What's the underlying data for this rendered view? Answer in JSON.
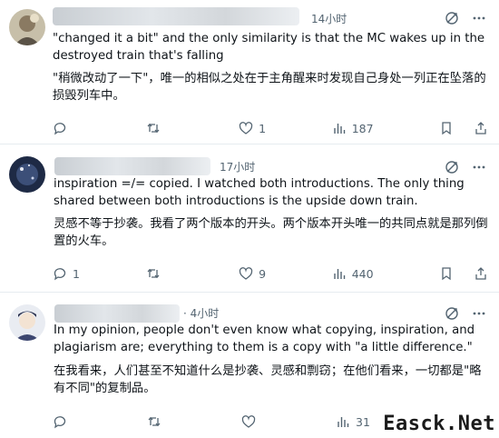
{
  "posts": [
    {
      "time": "14小时",
      "text_en": "\"changed it a bit\" and the only similarity is that the MC wakes up in the destroyed train that's falling",
      "text_zh": "\"稍微改动了一下\"，唯一的相似之处在于主角醒来时发现自己身处一列正在坠落的损毁列车中。",
      "reply_count": "",
      "retweet_count": "",
      "like_count": "1",
      "view_count": "187"
    },
    {
      "time": "17小时",
      "text_en": "inspiration =/= copied. I watched both introductions. The only thing shared between both introductions is the upside down train.",
      "text_zh": "灵感不等于抄袭。我看了两个版本的开头。两个版本开头唯一的共同点就是那列倒置的火车。",
      "reply_count": "1",
      "retweet_count": "",
      "like_count": "9",
      "view_count": "440"
    },
    {
      "time": "· 4小时",
      "text_en": "In my opinion, people don't even know what copying, inspiration, and plagiarism are; everything to them is a copy with \"a little difference.\"",
      "text_zh": "在我看来，人们甚至不知道什么是抄袭、灵感和剽窃；在他们看来，一切都是\"略有不同\"的复制品。",
      "reply_count": "",
      "retweet_count": "",
      "like_count": "",
      "view_count": "31"
    }
  ],
  "watermark": "Easck.Net",
  "icons": {
    "translate": "translate-icon",
    "more": "more-icon",
    "reply": "reply-icon",
    "retweet": "retweet-icon",
    "like": "like-icon",
    "views": "views-icon",
    "bookmark": "bookmark-icon",
    "share": "share-icon"
  },
  "colors": {
    "muted": "#536471",
    "text": "#0f1419",
    "divider": "#e6ecf0"
  }
}
